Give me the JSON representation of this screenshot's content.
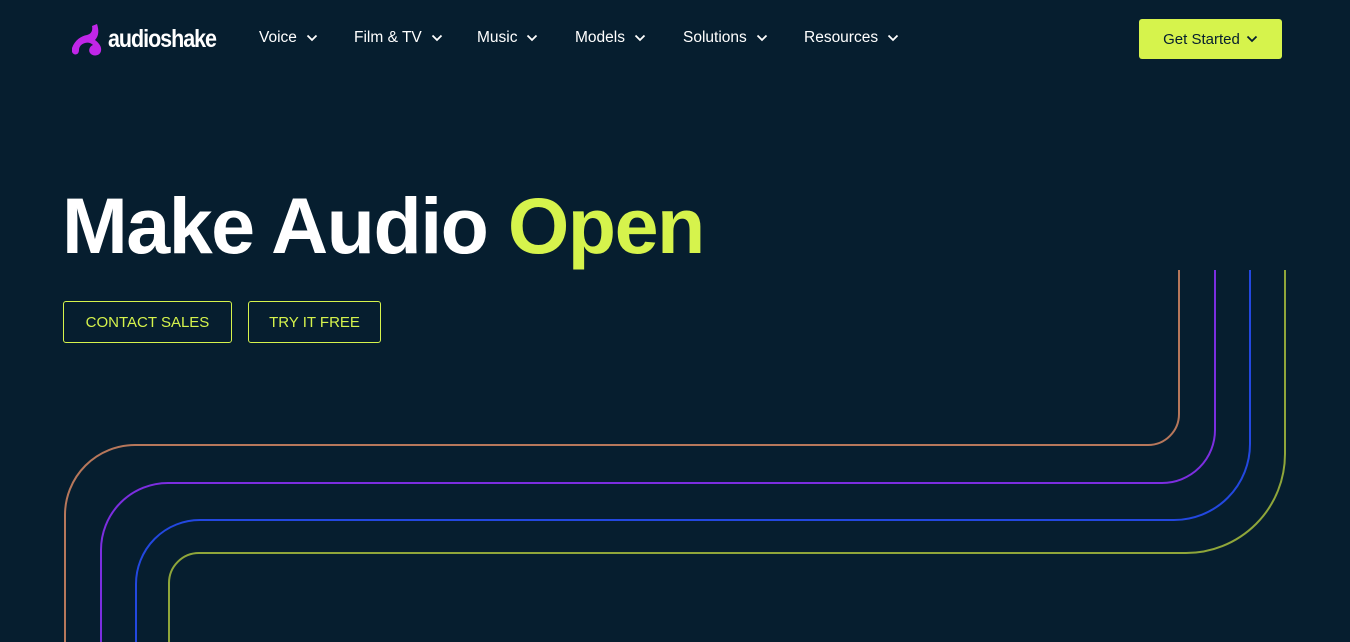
{
  "header": {
    "logo_text": "audioshake",
    "brand_colors": {
      "logo_mark": "#c026e8",
      "accent": "#d6f34c",
      "background": "#061e2f"
    },
    "nav": [
      {
        "label": "Voice",
        "icon": "chevron-down-icon"
      },
      {
        "label": "Film & TV",
        "icon": "chevron-down-icon"
      },
      {
        "label": "Music",
        "icon": "chevron-down-icon"
      },
      {
        "label": "Models",
        "icon": "chevron-down-icon"
      },
      {
        "label": "Solutions",
        "icon": "chevron-down-icon"
      },
      {
        "label": "Resources",
        "icon": "chevron-down-icon"
      }
    ],
    "cta_label": "Get Started"
  },
  "hero": {
    "title_main": "Make Audio",
    "title_accent": "Open",
    "buttons": {
      "contact_sales": "CONTACT SALES",
      "try_free": "TRY IT FREE"
    }
  },
  "decoration": {
    "line_colors": [
      "#b6775b",
      "#7c2ee0",
      "#2348e0",
      "#8fa63a"
    ]
  }
}
